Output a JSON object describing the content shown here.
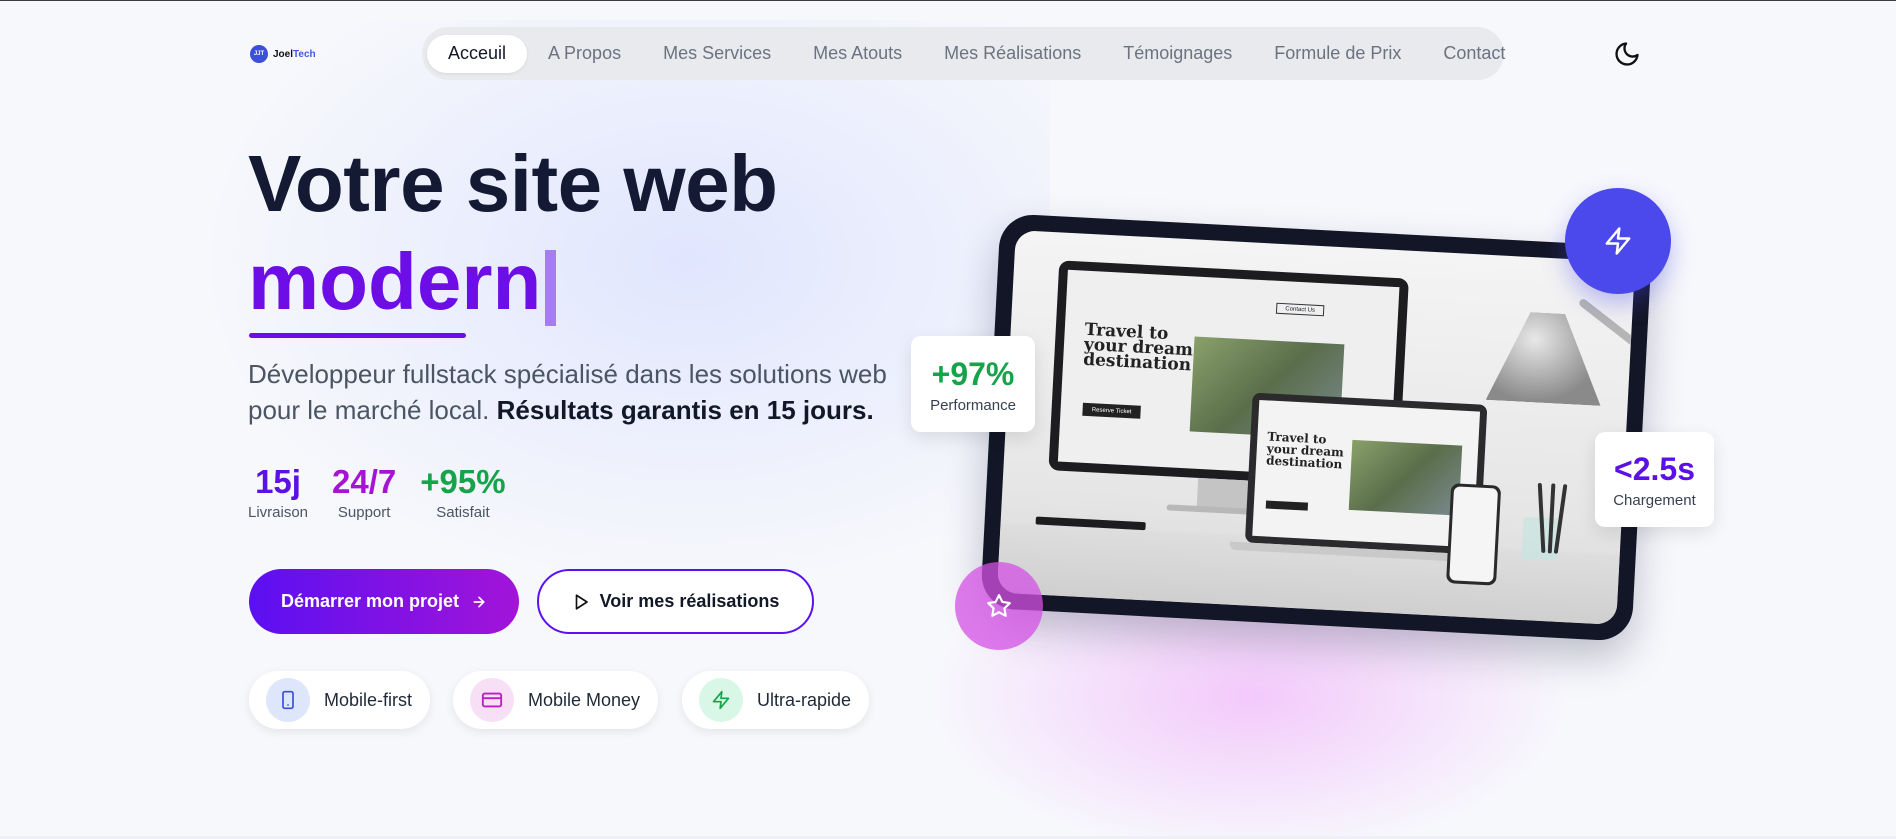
{
  "brand": {
    "logo_mark": "JJT",
    "name_part1": "Joel",
    "name_part2": "Tech"
  },
  "nav": {
    "items": [
      {
        "label": "Acceuil",
        "active": true
      },
      {
        "label": "A Propos"
      },
      {
        "label": "Mes Services"
      },
      {
        "label": "Mes Atouts"
      },
      {
        "label": "Mes Réalisations"
      },
      {
        "label": "Témoignages"
      },
      {
        "label": "Formule de Prix"
      },
      {
        "label": "Contact"
      }
    ],
    "theme_toggle_icon": "moon-icon"
  },
  "hero": {
    "title_line1": "Votre site web",
    "title_line2": "modern",
    "subtitle_text": "Développeur fullstack spécialisé dans les solutions web pour le marché local.",
    "subtitle_strong": "Résultats garantis en 15 jours.",
    "stats": [
      {
        "value": "15j",
        "label": "Livraison",
        "color": "#5b10e6"
      },
      {
        "value": "24/7",
        "label": "Support",
        "color": "#a514d4"
      },
      {
        "value": "+95%",
        "label": "Satisfait",
        "color": "#16a34a"
      }
    ],
    "cta_primary": "Démarrer mon projet",
    "cta_secondary": "Voir mes réalisations",
    "features": [
      {
        "label": "Mobile-first",
        "icon": "smartphone-icon"
      },
      {
        "label": "Mobile Money",
        "icon": "credit-card-icon"
      },
      {
        "label": "Ultra-rapide",
        "icon": "zap-icon"
      }
    ]
  },
  "illustration": {
    "site_heading": "Travel to your dream destination",
    "site_contact": "Contact Us",
    "site_button": "Reserve Ticket",
    "metrics": [
      {
        "value": "+97%",
        "label": "Performance",
        "color": "#16a34a"
      },
      {
        "value": "<2.5s",
        "label": "Chargement",
        "color": "#5b10e6"
      }
    ]
  },
  "colors": {
    "accent": "#6d0ee6",
    "gradient_start": "#5b10f2",
    "gradient_end": "#a214d8",
    "bolt_circle": "#4b49ec"
  }
}
